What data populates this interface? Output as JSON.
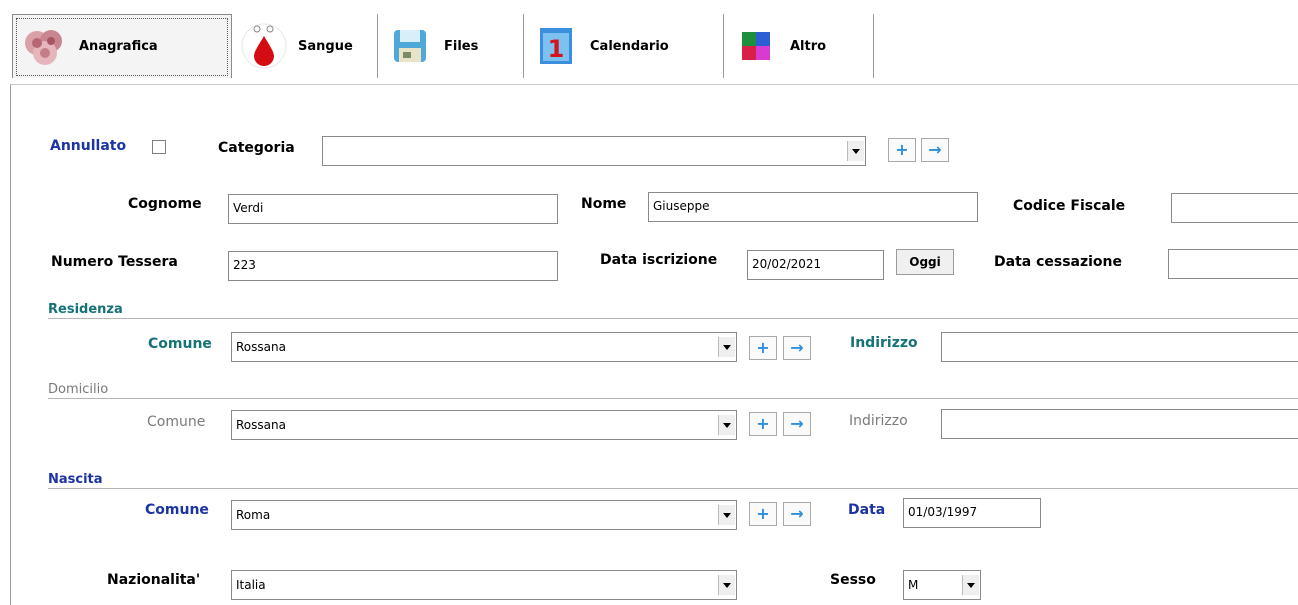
{
  "tabs": [
    {
      "label": "Anagrafica",
      "icon": "blood-cells-icon",
      "active": true
    },
    {
      "label": "Sangue",
      "icon": "blood-drop-icon",
      "active": false
    },
    {
      "label": "Files",
      "icon": "floppy-disk-icon",
      "active": false
    },
    {
      "label": "Calendario",
      "icon": "calendar-icon",
      "active": false
    },
    {
      "label": "Altro",
      "icon": "puzzle-icon",
      "active": false
    }
  ],
  "calendar_icon_number": "1",
  "form": {
    "annullato_label": "Annullato",
    "categoria_label": "Categoria",
    "categoria_value": "",
    "cognome_label": "Cognome",
    "cognome_value": "Verdi",
    "nome_label": "Nome",
    "nome_value": "Giuseppe",
    "codice_fiscale_label": "Codice Fiscale",
    "codice_fiscale_value": "",
    "numero_tessera_label": "Numero Tessera",
    "numero_tessera_value": "223",
    "data_iscrizione_label": "Data iscrizione",
    "data_iscrizione_value": "20/02/2021",
    "oggi_label": "Oggi",
    "data_cessazione_label": "Data cessazione",
    "data_cessazione_value": ""
  },
  "residenza": {
    "section": "Residenza",
    "comune_label": "Comune",
    "comune_value": "Rossana",
    "indirizzo_label": "Indirizzo",
    "indirizzo_value": ""
  },
  "domicilio": {
    "section": "Domicilio",
    "comune_label": "Comune",
    "comune_value": "Rossana",
    "indirizzo_label": "Indirizzo",
    "indirizzo_value": ""
  },
  "nascita": {
    "section": "Nascita",
    "comune_label": "Comune",
    "comune_value": "Roma",
    "data_label": "Data",
    "data_value": "01/03/1997"
  },
  "nazionalita": {
    "label": "Nazionalita'",
    "value": "Italia"
  },
  "sesso": {
    "label": "Sesso",
    "value": "M"
  },
  "buttons": {
    "add_symbol": "+",
    "goto_symbol": "→"
  },
  "colors": {
    "label_blue": "#1c33a6",
    "label_teal": "#157378",
    "label_gray": "#7a7a7a",
    "button_accent": "#2f8fdc"
  }
}
